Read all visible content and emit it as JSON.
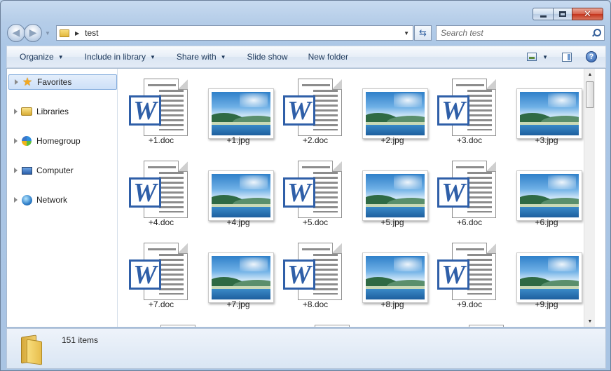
{
  "window": {
    "caption": {
      "minimize": "",
      "maximize": "",
      "close": "✕"
    }
  },
  "address": {
    "path": "test"
  },
  "search": {
    "placeholder": "Search test"
  },
  "commands": {
    "organize": "Organize",
    "include_in_library": "Include in library",
    "share_with": "Share with",
    "slide_show": "Slide show",
    "new_folder": "New folder"
  },
  "icons": {
    "back": "back-arrow-icon",
    "forward": "forward-arrow-icon",
    "refresh": "refresh-icon",
    "search": "search-icon",
    "views": "change-view-icon",
    "preview_pane": "preview-pane-icon",
    "help": "help-icon"
  },
  "nav": {
    "items": [
      {
        "label": "Favorites",
        "selected": true
      },
      {
        "label": "Libraries"
      },
      {
        "label": "Homegroup"
      },
      {
        "label": "Computer"
      },
      {
        "label": "Network"
      }
    ]
  },
  "files": [
    {
      "name": "+1.doc",
      "type": "doc"
    },
    {
      "name": "+1.jpg",
      "type": "jpg"
    },
    {
      "name": "+2.doc",
      "type": "doc"
    },
    {
      "name": "+2.jpg",
      "type": "jpg"
    },
    {
      "name": "+3.doc",
      "type": "doc"
    },
    {
      "name": "+3.jpg",
      "type": "jpg"
    },
    {
      "name": "+4.doc",
      "type": "doc"
    },
    {
      "name": "+4.jpg",
      "type": "jpg"
    },
    {
      "name": "+5.doc",
      "type": "doc"
    },
    {
      "name": "+5.jpg",
      "type": "jpg"
    },
    {
      "name": "+6.doc",
      "type": "doc"
    },
    {
      "name": "+6.jpg",
      "type": "jpg"
    },
    {
      "name": "+7.doc",
      "type": "doc"
    },
    {
      "name": "+7.jpg",
      "type": "jpg"
    },
    {
      "name": "+8.doc",
      "type": "doc"
    },
    {
      "name": "+8.jpg",
      "type": "jpg"
    },
    {
      "name": "+9.doc",
      "type": "doc"
    },
    {
      "name": "+9.jpg",
      "type": "jpg"
    }
  ],
  "status": {
    "item_count": "151 items"
  },
  "colors": {
    "word_blue": "#2f5fa8",
    "selection_border": "#84acdd",
    "command_text": "#1e395b"
  }
}
